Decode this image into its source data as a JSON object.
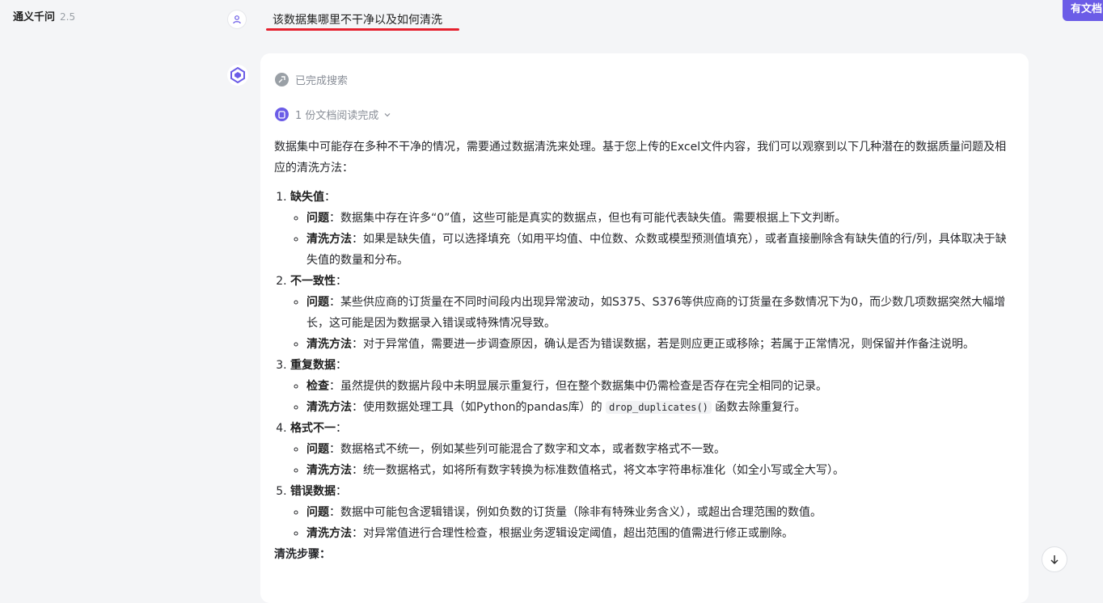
{
  "app": {
    "name": "通义千问",
    "version": "2.5"
  },
  "top_button": {
    "label": "有文档"
  },
  "user_question": "该数据集哪里不干净以及如何清洗",
  "status": {
    "search": "已完成搜索",
    "docs": "1 份文档阅读完成"
  },
  "answer": {
    "intro": "数据集中可能存在多种不干净的情况，需要通过数据清洗来处理。基于您上传的Excel文件内容，我们可以观察到以下几种潜在的数据质量问题及相应的清洗方法：",
    "sections": [
      {
        "title": "缺失值",
        "items": [
          {
            "label": "问题",
            "text": "：数据集中存在许多“0”值，这些可能是真实的数据点，但也有可能代表缺失值。需要根据上下文判断。"
          },
          {
            "label": "清洗方法",
            "text": "：如果是缺失值，可以选择填充（如用平均值、中位数、众数或模型预测值填充），或者直接删除含有缺失值的行/列，具体取决于缺失值的数量和分布。"
          }
        ]
      },
      {
        "title": "不一致性",
        "items": [
          {
            "label": "问题",
            "text": "：某些供应商的订货量在不同时间段内出现异常波动，如S375、S376等供应商的订货量在多数情况下为0，而少数几项数据突然大幅增长，这可能是因为数据录入错误或特殊情况导致。"
          },
          {
            "label": "清洗方法",
            "text": "：对于异常值，需要进一步调查原因，确认是否为错误数据，若是则应更正或移除；若属于正常情况，则保留并作备注说明。"
          }
        ]
      },
      {
        "title": "重复数据",
        "items": [
          {
            "label": "检查",
            "text": "：虽然提供的数据片段中未明显展示重复行，但在整个数据集中仍需检查是否存在完全相同的记录。"
          },
          {
            "label": "清洗方法",
            "text_before": "：使用数据处理工具（如Python的pandas库）的 ",
            "code": "drop_duplicates()",
            "text_after": " 函数去除重复行。"
          }
        ]
      },
      {
        "title": "格式不一",
        "items": [
          {
            "label": "问题",
            "text": "：数据格式不统一，例如某些列可能混合了数字和文本，或者数字格式不一致。"
          },
          {
            "label": "清洗方法",
            "text": "：统一数据格式，如将所有数字转换为标准数值格式，将文本字符串标准化（如全小写或全大写）。"
          }
        ]
      },
      {
        "title": "错误数据",
        "items": [
          {
            "label": "问题",
            "text": "：数据中可能包含逻辑错误，例如负数的订货量（除非有特殊业务含义），或超出合理范围的数值。"
          },
          {
            "label": "清洗方法",
            "text": "：对异常值进行合理性检查，根据业务逻辑设定阈值，超出范围的值需进行修正或删除。"
          }
        ]
      }
    ],
    "steps_title": "清洗步骤："
  },
  "colors": {
    "accent": "#6b5ce7",
    "underline": "#e5202e",
    "background": "#f4f5f7"
  },
  "icons": [
    "user-icon",
    "bot-logo-icon",
    "search-done-icon",
    "document-icon",
    "chevron-down-icon",
    "arrow-down-icon"
  ]
}
